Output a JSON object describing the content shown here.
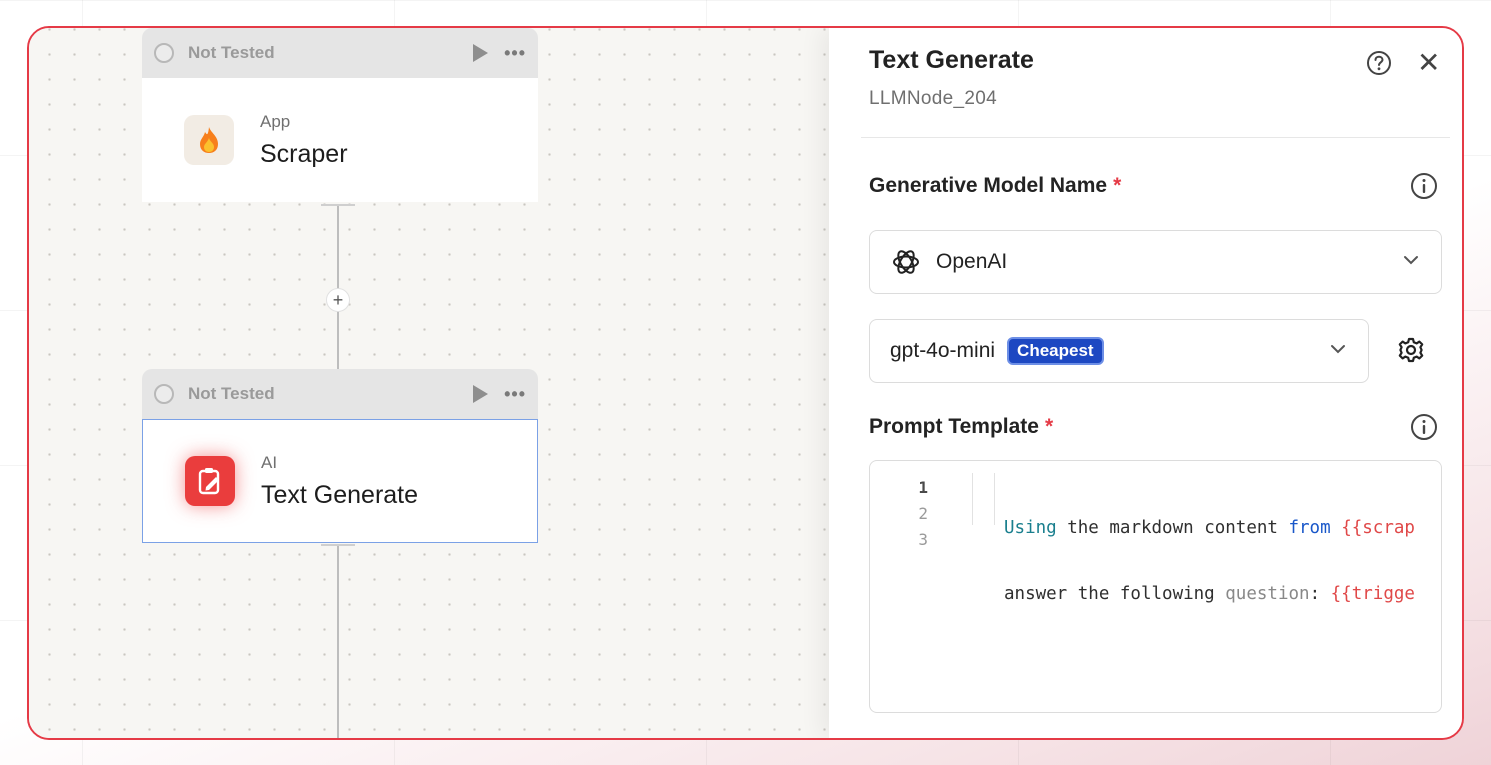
{
  "canvas": {
    "nodes": [
      {
        "status": "Not Tested",
        "kind": "App",
        "title": "Scraper",
        "icon": "fire-icon"
      },
      {
        "status": "Not Tested",
        "kind": "AI",
        "title": "Text Generate",
        "icon": "pen-clipboard-icon"
      }
    ],
    "add_step": "+"
  },
  "panel": {
    "title": "Text Generate",
    "subtitle": "LLMNode_204",
    "model_section": {
      "label": "Generative Model Name",
      "required_mark": "*",
      "provider": "OpenAI",
      "model": "gpt-4o-mini",
      "model_badge": "Cheapest"
    },
    "prompt_section": {
      "label": "Prompt Template",
      "required_mark": "*",
      "line_numbers": [
        "1",
        "2",
        "3"
      ],
      "line1": {
        "w1": "Using",
        "w2": " the markdown content ",
        "w3": "from",
        "w4": " ",
        "w5": "{{scrap"
      },
      "line2": {
        "w1": "answer the following ",
        "w2": "question",
        "w3": ": ",
        "w4": "{{trigge"
      }
    }
  },
  "colors": {
    "accent_red": "#e53a46",
    "badge_blue": "#1d48c2",
    "selected_border": "#7ba1e6"
  }
}
